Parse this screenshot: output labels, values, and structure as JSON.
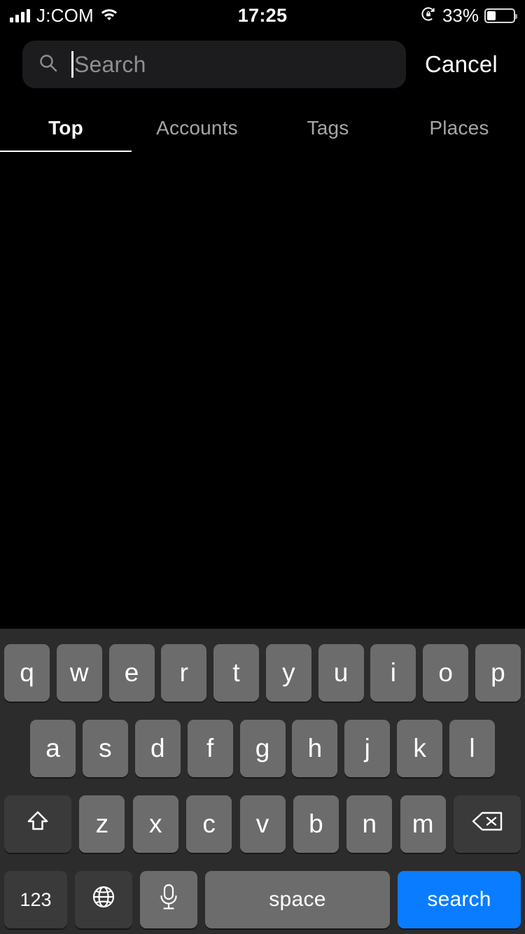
{
  "status_bar": {
    "carrier": "J:COM",
    "time": "17:25",
    "battery_percent": "33%",
    "battery_level": 33,
    "signal_bars": 4,
    "icons": [
      "signal-bars-icon",
      "wifi-icon",
      "rotation-lock-icon",
      "battery-icon"
    ]
  },
  "search": {
    "placeholder": "Search",
    "value": "",
    "cancel_label": "Cancel",
    "icon": "search-icon",
    "field_background": "#1C1C1E",
    "placeholder_color": "#8E8E93"
  },
  "tabs": {
    "active_index": 0,
    "items": [
      {
        "label": "Top"
      },
      {
        "label": "Accounts"
      },
      {
        "label": "Tags"
      },
      {
        "label": "Places"
      }
    ]
  },
  "results": {
    "items": [],
    "empty": ""
  },
  "keyboard": {
    "row1": [
      "q",
      "w",
      "e",
      "r",
      "t",
      "y",
      "u",
      "i",
      "o",
      "p"
    ],
    "row2": [
      "a",
      "s",
      "d",
      "f",
      "g",
      "h",
      "j",
      "k",
      "l"
    ],
    "row3": [
      "z",
      "x",
      "c",
      "v",
      "b",
      "n",
      "m"
    ],
    "shift_icon": "shift-icon",
    "backspace_icon": "backspace-icon",
    "numbers_label": "123",
    "globe_icon": "globe-icon",
    "mic_icon": "microphone-icon",
    "space_label": "space",
    "return_label": "search",
    "return_color": "#0A7CFF",
    "key_color": "#6C6C6C",
    "fn_key_color": "#3A3A3A",
    "background": "#2C2C2C"
  }
}
